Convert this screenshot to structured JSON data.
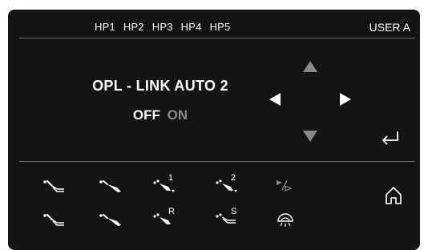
{
  "header": {
    "tabs": [
      "HP1",
      "HP2",
      "HP3",
      "HP4",
      "HP5"
    ],
    "user": "USER A"
  },
  "main": {
    "title": "OPL - LINK  AUTO 2",
    "toggle_off": "OFF",
    "toggle_on": "ON"
  },
  "tools": {
    "labels": {
      "hp3": "1",
      "hp4": "2",
      "reverse": "R",
      "spray": "S"
    },
    "icons": [
      "handpiece-1-icon",
      "handpiece-2-icon",
      "handpiece-3-icon",
      "handpiece-4-icon",
      "forward-reverse-icon",
      "handpiece-5-icon",
      "handpiece-6-icon",
      "handpiece-reverse-icon",
      "handpiece-spray-icon",
      "operating-light-icon"
    ]
  },
  "colors": {
    "panel_bg": "#141416",
    "text": "#ffffff",
    "inactive": "#8a8a8c",
    "divider": "#6d6d70"
  }
}
